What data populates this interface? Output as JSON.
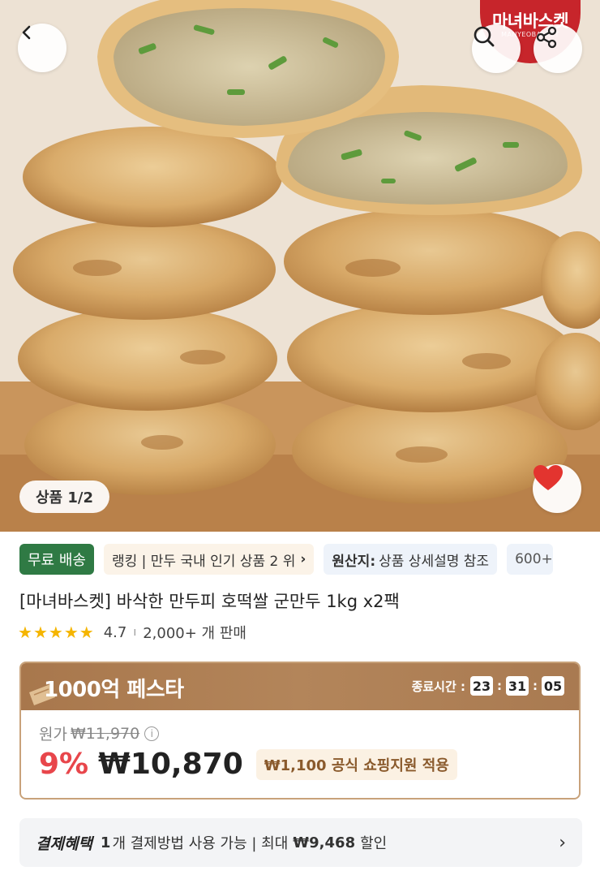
{
  "header": {
    "brand_name": "마녀바스켓",
    "brand_sub": "MANYEOBASKET"
  },
  "hero": {
    "image_counter": "상품 1/2",
    "wishlist_active": true
  },
  "tags": {
    "free_shipping": "무료 배송",
    "ranking": "랭킹 | 만두 국내 인기 상품 2 위",
    "origin_label": "원산지:",
    "origin_value": "상품 상세설명 참조",
    "more": "600+"
  },
  "product": {
    "title": "[마녀바스켓] 바삭한 만두피 호떡쌀 군만두 1kg x2팩",
    "rating": "4.7",
    "sales": "2,000+ 개 판매"
  },
  "promo": {
    "title": "1000억 페스타",
    "timer_label": "종료시간 :",
    "hours": "23",
    "minutes": "31",
    "seconds": "05",
    "original_label": "원가",
    "original_price": "₩11,970",
    "discount": "9%",
    "price": "₩10,870",
    "support_text": "₩1,100 공식 쇼핑지원 적용"
  },
  "benefit": {
    "label": "결제혜택",
    "count": "1",
    "text_mid": "개 결제방법 사용 가능 | 최대",
    "max_amount": "₩9,468",
    "text_end": "할인"
  },
  "colors": {
    "free_shipping_bg": "#2f7a44",
    "discount_red": "#e8464b",
    "promo_brown": "#a8774c",
    "star_yellow": "#f5b500",
    "heart_red": "#e3342f"
  }
}
